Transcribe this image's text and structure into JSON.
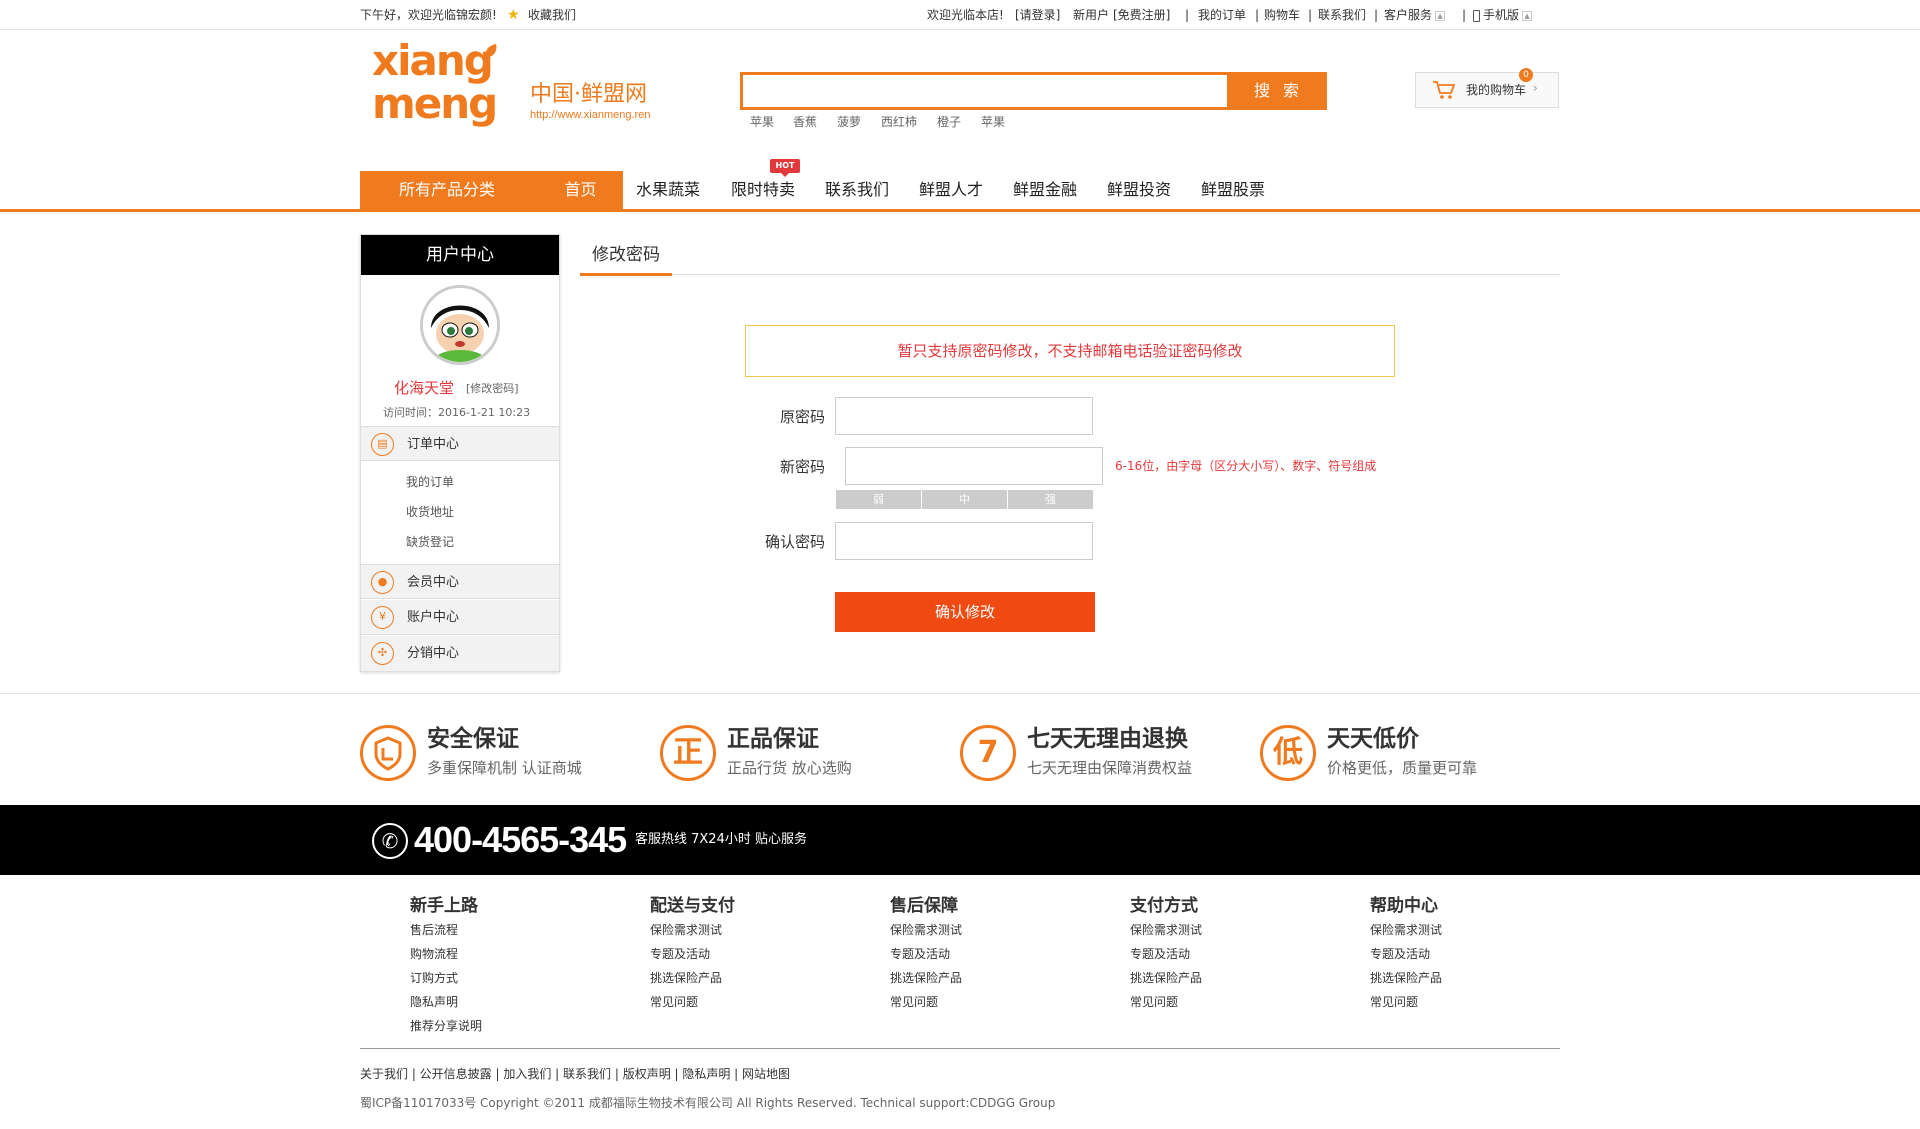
{
  "topbar": {
    "greeting": "下午好，欢迎光临锦宏颜!",
    "favorite": "收藏我们",
    "welcome": "欢迎光临本店!",
    "login": "[请登录]",
    "new_user": "新用户",
    "register": "[免费注册]",
    "my_orders": "我的订单",
    "cart": "购物车",
    "contact": "联系我们",
    "service": "客户服务",
    "mobile": "手机版"
  },
  "header": {
    "logo_top": "xiang",
    "logo_bottom": "meng",
    "logo_cn": "中国·鲜盟网",
    "logo_url": "http://www.xianmeng.ren",
    "search_button": "搜 索",
    "hot_words": [
      "苹果",
      "香蕉",
      "菠萝",
      "西红柿",
      "橙子",
      "苹果"
    ],
    "cart_label": "我的购物车",
    "cart_count": "0"
  },
  "nav": {
    "all_categories": "所有产品分类",
    "home": "首页",
    "items": [
      "水果蔬菜",
      "限时特卖",
      "联系我们",
      "鲜盟人才",
      "鲜盟金融",
      "鲜盟投资",
      "鲜盟股票"
    ],
    "hot_badge": "HOT"
  },
  "sidebar": {
    "title": "用户中心",
    "username": "化海天堂",
    "change_password_link": "[修改密码]",
    "visit_time": "访问时间：2016-1-21 10:23",
    "order_center": "订单中心",
    "order_subitems": [
      "我的订单",
      "收货地址",
      "缺货登记"
    ],
    "member_center": "会员中心",
    "account_center": "账户中心",
    "account_symbol": "¥",
    "distribution_center": "分销中心"
  },
  "main": {
    "tab": "修改密码",
    "notice": "暂只支持原密码修改，不支持邮箱电话验证密码修改",
    "old_password_label": "原密码",
    "new_password_label": "新密码",
    "confirm_password_label": "确认密码",
    "password_hint": "6-16位，由字母（区分大小写）、数字、符号组成",
    "strength": [
      "弱",
      "中",
      "强"
    ],
    "submit": "确认修改"
  },
  "guarantees": [
    {
      "icon_text": "",
      "title": "安全保证",
      "subtitle": "多重保障机制 认证商城"
    },
    {
      "icon_text": "正",
      "title": "正品保证",
      "subtitle": "正品行货 放心选购"
    },
    {
      "icon_text": "7",
      "title": "七天无理由退换",
      "subtitle": "七天无理由保障消费权益"
    },
    {
      "icon_text": "低",
      "title": "天天低价",
      "subtitle": "价格更低，质量更可靠"
    }
  ],
  "hotline": {
    "number": "400-4565-345",
    "text": "客服热线 7X24小时 贴心服务"
  },
  "footer": {
    "columns": [
      {
        "title": "新手上路",
        "links": [
          "售后流程",
          "购物流程",
          "订购方式",
          "隐私声明",
          "推荐分享说明"
        ]
      },
      {
        "title": "配送与支付",
        "links": [
          "保险需求测试",
          "专题及活动",
          "挑选保险产品",
          "常见问题"
        ]
      },
      {
        "title": "售后保障",
        "links": [
          "保险需求测试",
          "专题及活动",
          "挑选保险产品",
          "常见问题"
        ]
      },
      {
        "title": "支付方式",
        "links": [
          "保险需求测试",
          "专题及活动",
          "挑选保险产品",
          "常见问题"
        ]
      },
      {
        "title": "帮助中心",
        "links": [
          "保险需求测试",
          "专题及活动",
          "挑选保险产品",
          "常见问题"
        ]
      }
    ],
    "bottom_links": "关于我们 | 公开信息披露 | 加入我们 | 联系我们 | 版权声明 | 隐私声明 | 网站地图",
    "copyright": "蜀ICP备11017033号 Copyright ©2011 成都福际生物技术有限公司 All Rights Reserved. Technical support:CDDGG Group"
  },
  "colors": {
    "accent": "#f07a1e",
    "alert": "#e4393c",
    "submit": "#f04a13"
  }
}
